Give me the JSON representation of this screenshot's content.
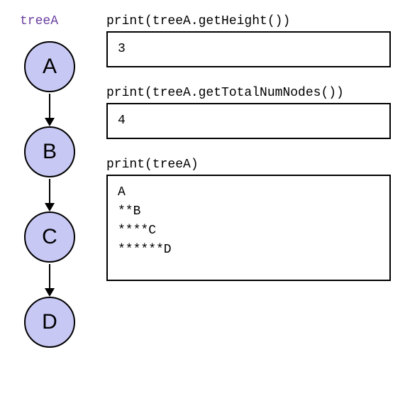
{
  "tree": {
    "label": "treeA",
    "nodes": [
      "A",
      "B",
      "C",
      "D"
    ]
  },
  "blocks": [
    {
      "code": "print(treeA.getHeight())",
      "output": "3",
      "tall": false
    },
    {
      "code": "print(treeA.getTotalNumNodes())",
      "output": "4",
      "tall": false
    },
    {
      "code": "print(treeA)",
      "output": "A\n**B\n****C\n******D",
      "tall": true
    }
  ]
}
